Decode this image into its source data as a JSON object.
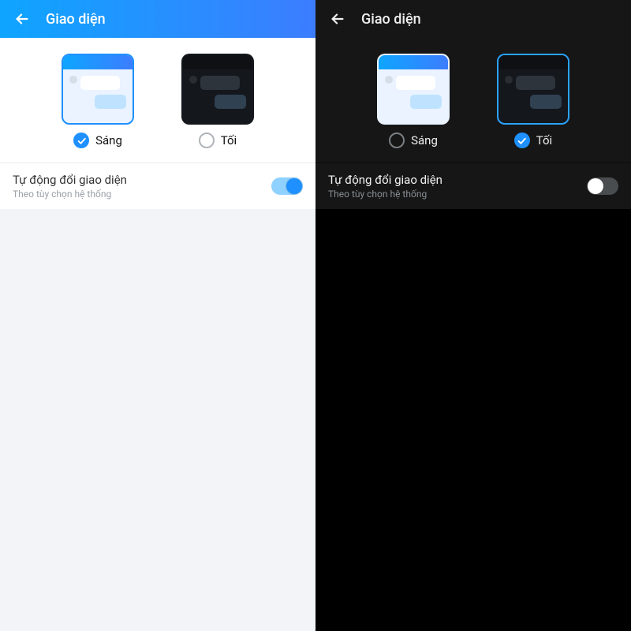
{
  "left": {
    "header_title": "Giao diện",
    "options": {
      "light": {
        "label": "Sáng",
        "selected": true
      },
      "dark": {
        "label": "Tối",
        "selected": false
      }
    },
    "auto": {
      "title": "Tự động đổi giao diện",
      "subtitle": "Theo tùy chọn hệ thống",
      "enabled": true
    }
  },
  "right": {
    "header_title": "Giao diện",
    "options": {
      "light": {
        "label": "Sáng",
        "selected": false
      },
      "dark": {
        "label": "Tối",
        "selected": true
      }
    },
    "auto": {
      "title": "Tự động đổi giao diện",
      "subtitle": "Theo tùy chọn hệ thống",
      "enabled": false
    }
  },
  "colors": {
    "accent": "#1e90ff"
  }
}
